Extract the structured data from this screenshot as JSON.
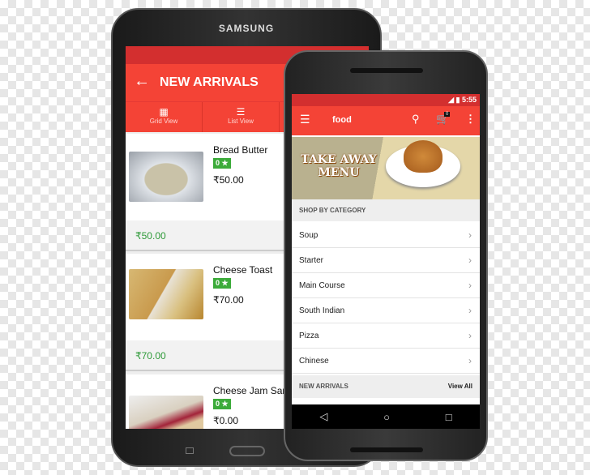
{
  "tablet": {
    "brand": "SAMSUNG",
    "toolbar": {
      "back_icon": "arrow-left-icon",
      "title": "NEW ARRIVALS"
    },
    "tabs": [
      {
        "label": "Grid View",
        "icon": "grid-icon"
      },
      {
        "label": "List View",
        "icon": "list-icon"
      }
    ],
    "products": [
      {
        "name": "Bread Butter",
        "rating": "0 ★",
        "price": "₹50.00",
        "footer_price": "₹50.00"
      },
      {
        "name": "Cheese Toast",
        "rating": "0 ★",
        "price": "₹70.00",
        "footer_price": "₹70.00"
      },
      {
        "name": "Cheese Jam Sandwich",
        "rating": "0 ★",
        "price": "₹0.00"
      }
    ]
  },
  "phone": {
    "status": {
      "time": "5:55"
    },
    "toolbar": {
      "title": "food",
      "cart_count": "0"
    },
    "banner": {
      "text_line1": "TAKE AWAY",
      "text_line2": "MENU"
    },
    "category_header": "SHOP BY CATEGORY",
    "categories": [
      "Soup",
      "Starter",
      "Main Course",
      "South Indian",
      "Pizza",
      "Chinese"
    ],
    "new_arrivals": {
      "label": "NEW ARRIVALS",
      "view_all": "View All"
    }
  },
  "colors": {
    "primary": "#f44336",
    "dark": "#d32f2f",
    "rating": "#3cab3a",
    "price_green": "#2e9a38"
  }
}
